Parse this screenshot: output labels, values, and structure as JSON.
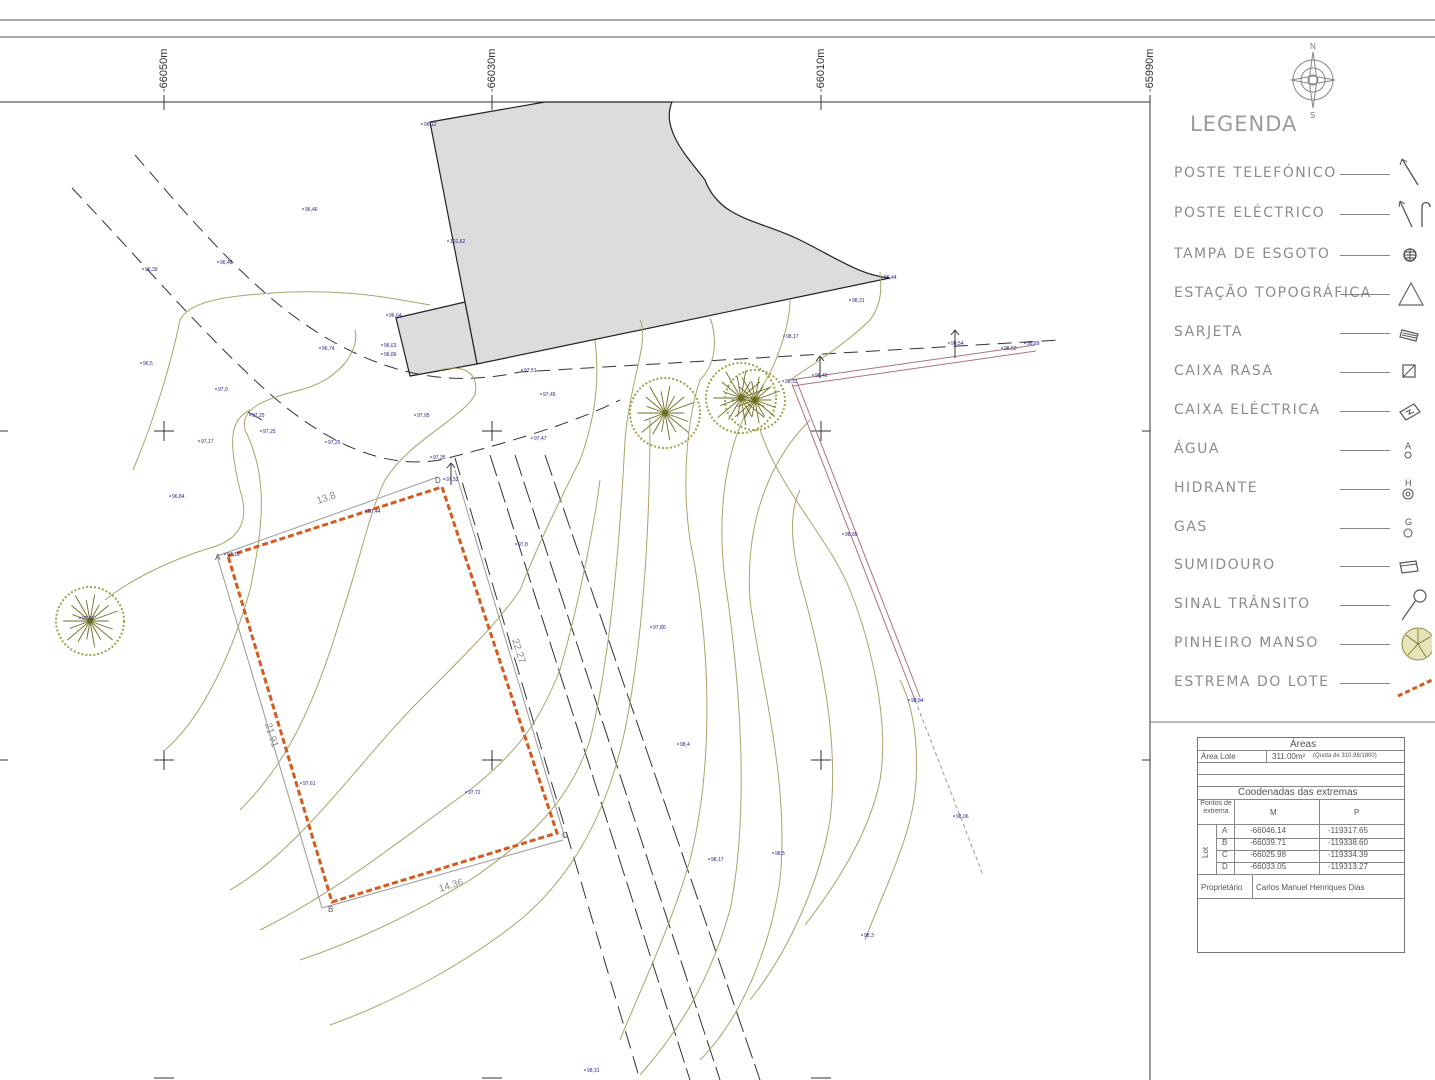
{
  "grid": {
    "coord_labels": [
      "-66050m",
      "-66030m",
      "-66010m",
      "-65990m"
    ]
  },
  "north_arrow": {
    "n": "N",
    "s": "S"
  },
  "legend": {
    "title": "LEGENDA",
    "items": [
      {
        "label": "POSTE TELEFÓNICO",
        "icon": "telephone-pole-icon"
      },
      {
        "label": "POSTE ELÉCTRICO",
        "icon": "electric-pole-icon"
      },
      {
        "label": "TAMPA DE ESGOTO",
        "icon": "sewer-cover-icon"
      },
      {
        "label": "ESTAÇÃO TOPOGRÁFICA",
        "icon": "survey-station-icon"
      },
      {
        "label": "SARJETA",
        "icon": "gutter-icon"
      },
      {
        "label": "CAIXA RASA",
        "icon": "shallow-box-icon"
      },
      {
        "label": "CAIXA ELÉCTRICA",
        "icon": "electric-box-icon"
      },
      {
        "label": "ÁGUA",
        "icon": "water-icon"
      },
      {
        "label": "HIDRANTE",
        "icon": "hydrant-icon"
      },
      {
        "label": "GAS",
        "icon": "gas-icon"
      },
      {
        "label": "SUMIDOURO",
        "icon": "drain-icon"
      },
      {
        "label": "SINAL TRÂNSITO",
        "icon": "traffic-sign-icon"
      },
      {
        "label": "PINHEIRO MANSO",
        "icon": "stone-pine-icon"
      },
      {
        "label": "ESTREMA DO LOTE",
        "icon": "lot-boundary-icon"
      }
    ]
  },
  "lot": {
    "corners": [
      "A",
      "B",
      "C",
      "D"
    ],
    "dimensions": [
      "13.8",
      "22.27",
      "21.91",
      "14.36"
    ]
  },
  "spot_heights": [
    "96,12",
    "96,46",
    "96,49",
    "96,39",
    "96,5",
    "101,62",
    "96,64",
    "96,63",
    "96,89",
    "96,74",
    "96,44",
    "98,31",
    "98,17",
    "97,51",
    "97,45",
    "97,05",
    "97,0",
    "97,25",
    "97,25",
    "97,17",
    "97,25",
    "96,84",
    "97,47",
    "97,35",
    "97,52",
    "97,44",
    "97,13",
    "97,02",
    "97,8",
    "97,80",
    "97,61",
    "97,72",
    "98,17",
    "98,5",
    "98,4",
    "98,06",
    "98,3",
    "98,84",
    "98,85",
    "98,54",
    "98,53",
    "98,89",
    "98,46",
    "98,33",
    "98,31"
  ],
  "table": {
    "areas_header": "Áreas",
    "area_lote_label": "Área Lote",
    "area_lote_value": "311.00m²",
    "area_note": "(Quota de 310.98/1800)",
    "coords_header": "Coodenadas das extremas",
    "col_points": "Pontos de extrema",
    "col_m": "M",
    "col_p": "P",
    "group_label": "Lot",
    "rows": [
      {
        "pt": "A",
        "m": "-66046.14",
        "p": "-119317.65"
      },
      {
        "pt": "B",
        "m": "-66039.71",
        "p": "-119338.60"
      },
      {
        "pt": "C",
        "m": "-66025.98",
        "p": "-119334.39"
      },
      {
        "pt": "D",
        "m": "-66033.05",
        "p": "-119313.27"
      }
    ],
    "owner_label": "Proprietário",
    "owner_value": "Carlos Manuel Henriques Dias"
  }
}
